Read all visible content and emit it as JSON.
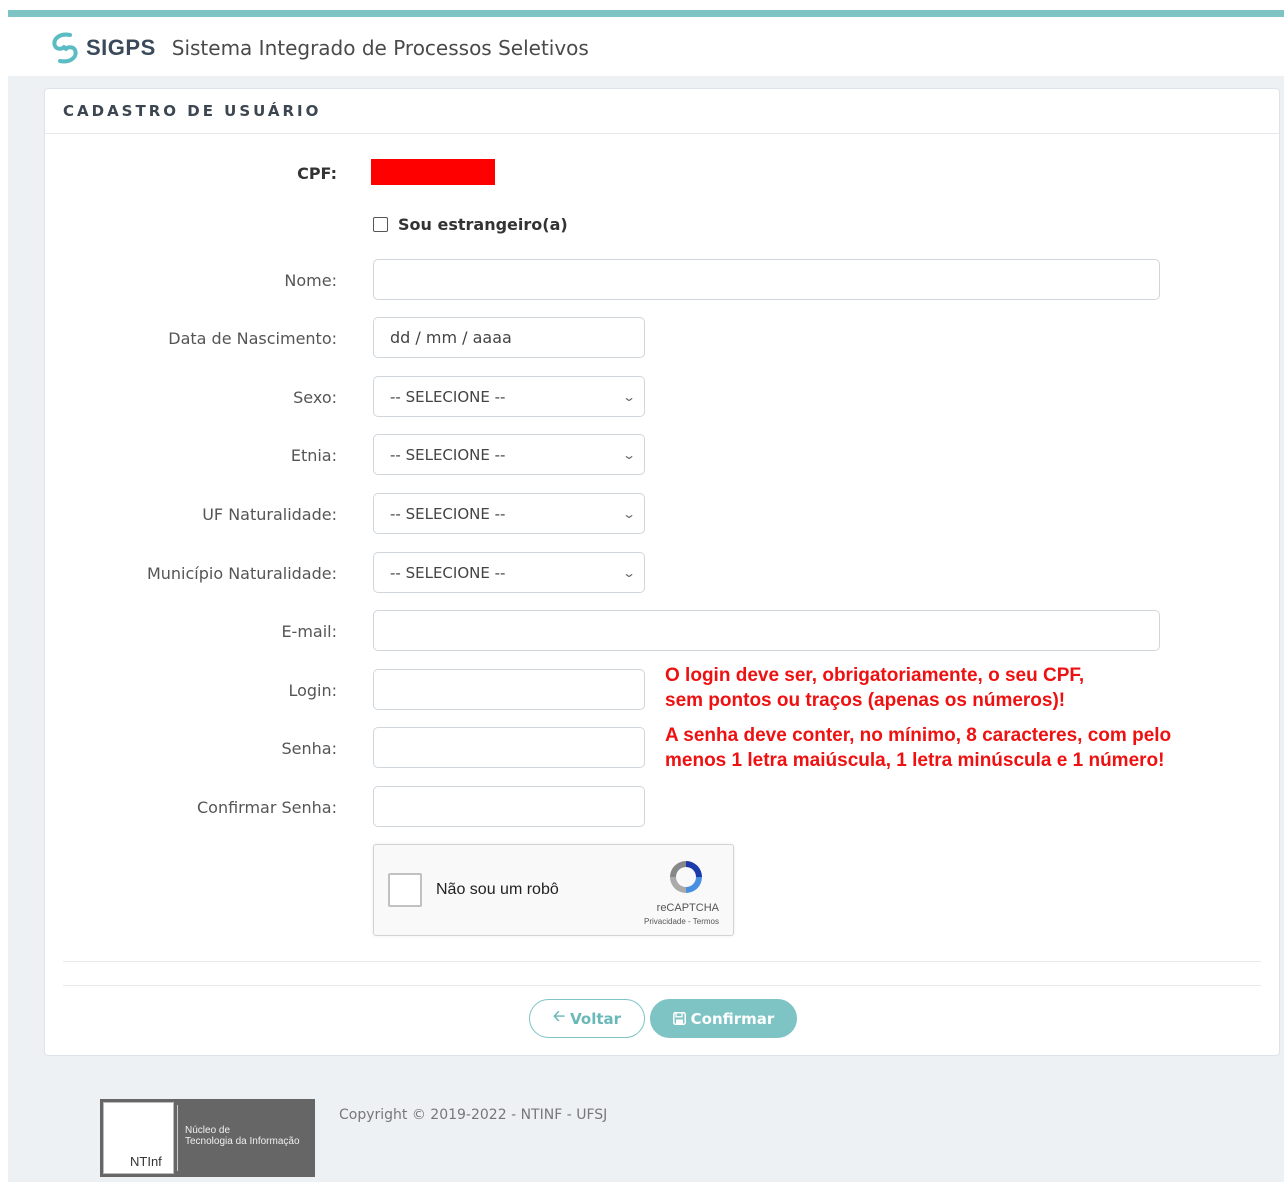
{
  "header": {
    "brand_name": "SIGPS",
    "subtitle": "Sistema Integrado de Processos Seletivos",
    "accent_color": "#7ec4c4"
  },
  "card": {
    "title": "CADASTRO DE USUÁRIO"
  },
  "form": {
    "cpf_label": "CPF:",
    "foreign_label": "Sou estrangeiro(a)",
    "foreign_checked": false,
    "nome_label": "Nome:",
    "nome_value": "",
    "nascimento_label": "Data de Nascimento:",
    "nascimento_placeholder": "dd / mm / aaaa",
    "sexo_label": "Sexo:",
    "sexo_value": "-- SELECIONE --",
    "etnia_label": "Etnia:",
    "etnia_value": "-- SELECIONE --",
    "uf_label": "UF Naturalidade:",
    "uf_value": "-- SELECIONE --",
    "municipio_label": "Município Naturalidade:",
    "municipio_value": "-- SELECIONE --",
    "email_label": "E-mail:",
    "email_value": "",
    "login_label": "Login:",
    "login_value": "",
    "senha_label": "Senha:",
    "senha_value": "",
    "confirmar_senha_label": "Confirmar Senha:",
    "confirmar_senha_value": ""
  },
  "warnings": {
    "login_line1": "O login deve ser, obrigatoriamente, o seu CPF,",
    "login_line2": "sem pontos ou traços (apenas os números)!",
    "senha_line1": "A senha deve conter, no mínimo, 8 caracteres, com pelo",
    "senha_line2": "menos 1 letra maiúscula, 1 letra minúscula e 1 número!",
    "color": "#ee1111"
  },
  "recaptcha": {
    "label": "Não sou um robô",
    "brand": "reCAPTCHA",
    "links": "Privacidade - Termos"
  },
  "buttons": {
    "voltar_icon": "arrow-left-icon",
    "voltar_label": "Voltar",
    "confirmar_icon": "save-icon",
    "confirmar_label": "Confirmar"
  },
  "footer": {
    "logo_short": "NTInf",
    "logo_line1": "Núcleo de",
    "logo_line2": "Tecnologia da Informação",
    "copyright": "Copyright © 2019-2022 - NTINF - UFSJ"
  }
}
